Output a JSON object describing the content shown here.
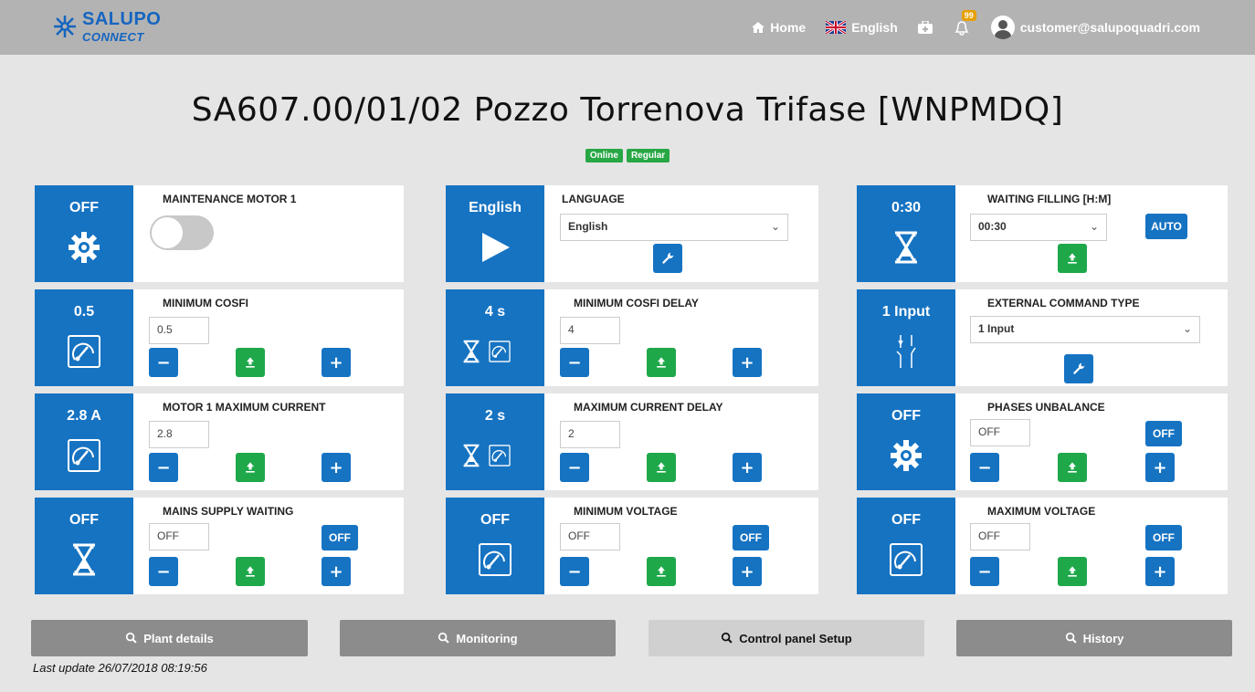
{
  "header": {
    "logo_line1": "SALUPO",
    "logo_line2": "CONNECT",
    "home_label": "Home",
    "language_label": "English",
    "notifications_count": "99",
    "user_email": "customer@salupoquadri.com"
  },
  "page": {
    "title": "SA607.00/01/02 Pozzo Torrenova Trifase [WNPMDQ]",
    "status_online": "Online",
    "status_regular": "Regular"
  },
  "cards": {
    "maintenance_motor": {
      "value": "OFF",
      "label": "MAINTENANCE MOTOR 1",
      "toggle_on": false
    },
    "language": {
      "value": "English",
      "label": "LANGUAGE",
      "selected": "English"
    },
    "waiting_filling": {
      "value": "0:30",
      "label": "WAITING FILLING [H:M]",
      "selected": "00:30",
      "auto_label": "AUTO"
    },
    "min_cosfi": {
      "value": "0.5",
      "label": "MINIMUM COSFI",
      "input": "0.5"
    },
    "min_cosfi_delay": {
      "value": "4 s",
      "label": "MINIMUM COSFI DELAY",
      "input": "4"
    },
    "ext_command": {
      "value": "1 Input",
      "label": "EXTERNAL COMMAND TYPE",
      "selected": "1 Input"
    },
    "motor_max_current": {
      "value": "2.8 A",
      "label": "MOTOR 1 MAXIMUM CURRENT",
      "input": "2.8"
    },
    "max_current_delay": {
      "value": "2 s",
      "label": "MAXIMUM CURRENT DELAY",
      "input": "2"
    },
    "phases_unbalance": {
      "value": "OFF",
      "label": "PHASES UNBALANCE",
      "input": "OFF",
      "off_label": "OFF"
    },
    "mains_supply": {
      "value": "OFF",
      "label": "MAINS SUPPLY WAITING",
      "input": "OFF",
      "off_label": "OFF"
    },
    "min_voltage": {
      "value": "OFF",
      "label": "MINIMUM VOLTAGE",
      "input": "OFF",
      "off_label": "OFF"
    },
    "max_voltage": {
      "value": "OFF",
      "label": "MAXIMUM VOLTAGE",
      "input": "OFF",
      "off_label": "OFF"
    }
  },
  "bottom_nav": {
    "plant_details": "Plant details",
    "monitoring": "Monitoring",
    "control_panel": "Control panel Setup",
    "history": "History"
  },
  "footer": {
    "last_update": "Last update 26/07/2018 08:19:56"
  },
  "colors": {
    "primary": "#1673c2",
    "success": "#1ea84a",
    "topbar": "#b3b3b3",
    "background": "#e5e5e5"
  },
  "icons": {
    "gear": "gear-icon",
    "flag": "flag-icon",
    "hourglass": "hourglass-icon",
    "meter": "meter-icon",
    "switch": "switch-icon",
    "wrench": "wrench-icon",
    "upload": "upload-icon",
    "search": "search-icon"
  }
}
